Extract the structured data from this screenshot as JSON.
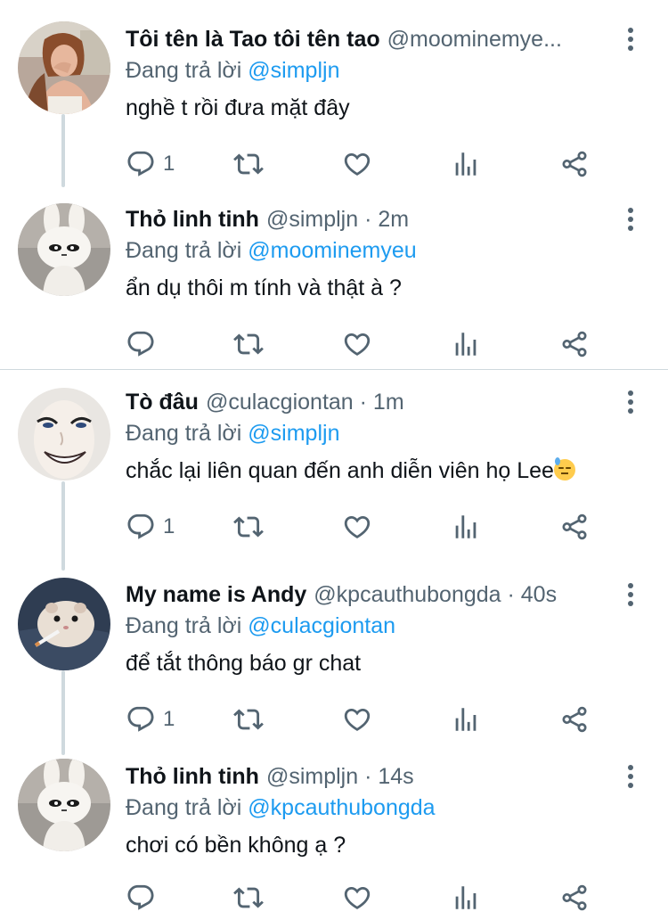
{
  "tweets": [
    {
      "name": "Tôi tên là Tao tôi tên tao",
      "meta": "@moominemye...",
      "reply_prefix": "Đang trả lời",
      "reply_mention": "@simpljn",
      "text": "nghề t rồi đưa mặt đây",
      "reply_count": "1",
      "avatar_icon": "woman-photo-avatar"
    },
    {
      "name": "Thỏ linh tinh",
      "meta": "@simpljn · 2m",
      "reply_prefix": "Đang trả lời",
      "reply_mention": "@moominemyeu",
      "text": "ẩn dụ thôi m tính và thật à ?",
      "reply_count": "",
      "avatar_icon": "bunny-plush-avatar"
    },
    {
      "name": "Tò đâu",
      "meta": "@culacgiontan · 1m",
      "reply_prefix": "Đang trả lời",
      "reply_mention": "@simpljn",
      "text": "chắc lại liên quan đến anh diễn viên họ Lee",
      "emoji": "downcast-face-with-sweat",
      "reply_count": "1",
      "avatar_icon": "smiling-mask-avatar"
    },
    {
      "name": "My name is Andy",
      "meta": "@kpcauthubongda · 40s",
      "reply_prefix": "Đang trả lời",
      "reply_mention": "@culacgiontan",
      "text": "để tắt thông báo gr chat",
      "reply_count": "1",
      "avatar_icon": "hamster-avatar"
    },
    {
      "name": "Thỏ linh tinh",
      "meta": "@simpljn · 14s",
      "reply_prefix": "Đang trả lời",
      "reply_mention": "@kpcauthubongda",
      "text": "chơi có bền không ạ ?",
      "reply_count": "",
      "avatar_icon": "bunny-plush-avatar"
    }
  ],
  "colors": {
    "text": "#0f1419",
    "secondary": "#536471",
    "link": "#1d9bf0",
    "thread_line": "#cfd9de"
  },
  "icons": [
    "reply-icon",
    "retweet-icon",
    "like-icon",
    "views-icon",
    "share-icon",
    "more-icon"
  ]
}
